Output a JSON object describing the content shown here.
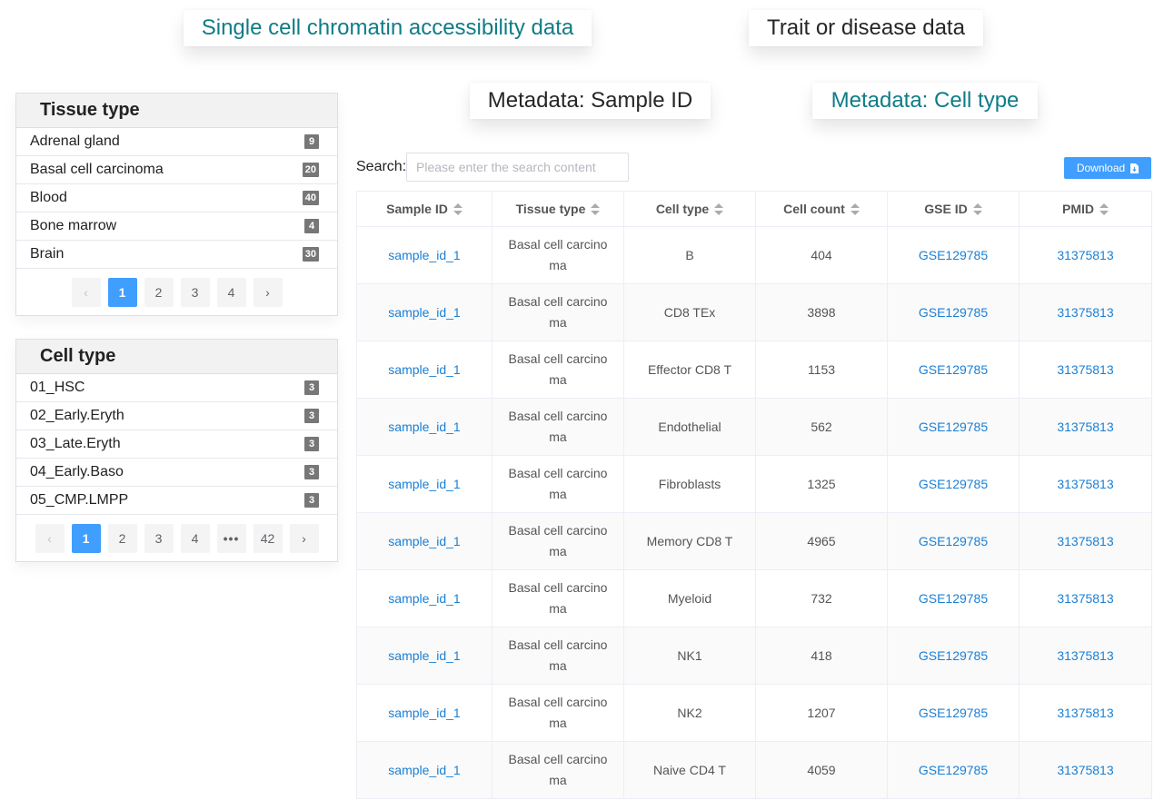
{
  "tabs_top": [
    {
      "label": "Single cell chromatin accessibility data",
      "active": true
    },
    {
      "label": "Trait or disease data",
      "active": false
    }
  ],
  "tabs_meta": [
    {
      "label": "Metadata: Sample ID",
      "active": false
    },
    {
      "label": "Metadata: Cell type",
      "active": true
    }
  ],
  "colors": {
    "accent": "#0f7c86",
    "primary": "#409eff",
    "link": "#1a7fd4",
    "badge": "#777777"
  },
  "tissue_panel": {
    "title": "Tissue type",
    "items": [
      {
        "label": "Adrenal gland",
        "count": "9"
      },
      {
        "label": "Basal cell carcinoma",
        "count": "20"
      },
      {
        "label": "Blood",
        "count": "40"
      },
      {
        "label": "Bone marrow",
        "count": "4"
      },
      {
        "label": "Brain",
        "count": "30"
      }
    ],
    "pagination": {
      "prev": "‹",
      "pages": [
        "1",
        "2",
        "3",
        "4"
      ],
      "current": "1",
      "next": "›"
    }
  },
  "cell_panel": {
    "title": "Cell type",
    "items": [
      {
        "label": "01_HSC",
        "count": "3"
      },
      {
        "label": "02_Early.Eryth",
        "count": "3"
      },
      {
        "label": "03_Late.Eryth",
        "count": "3"
      },
      {
        "label": "04_Early.Baso",
        "count": "3"
      },
      {
        "label": "05_CMP.LMPP",
        "count": "3"
      }
    ],
    "pagination": {
      "prev": "‹",
      "pages": [
        "1",
        "2",
        "3",
        "4",
        "•••",
        "42"
      ],
      "current": "1",
      "next": "›"
    }
  },
  "search": {
    "label": "Search:",
    "placeholder": "Please enter the search content",
    "value": ""
  },
  "download": {
    "label": "Download",
    "icon": "file-download-icon"
  },
  "table": {
    "headers": [
      "Sample ID",
      "Tissue type",
      "Cell type",
      "Cell count",
      "GSE ID",
      "PMID"
    ],
    "rows": [
      {
        "sample_id": "sample_id_1",
        "tissue": "Basal cell carcinoma",
        "cell_type": "B",
        "cell_count": "404",
        "gse": "GSE129785",
        "pmid": "31375813"
      },
      {
        "sample_id": "sample_id_1",
        "tissue": "Basal cell carcinoma",
        "cell_type": "CD8 TEx",
        "cell_count": "3898",
        "gse": "GSE129785",
        "pmid": "31375813"
      },
      {
        "sample_id": "sample_id_1",
        "tissue": "Basal cell carcinoma",
        "cell_type": "Effector CD8 T",
        "cell_count": "1153",
        "gse": "GSE129785",
        "pmid": "31375813"
      },
      {
        "sample_id": "sample_id_1",
        "tissue": "Basal cell carcinoma",
        "cell_type": "Endothelial",
        "cell_count": "562",
        "gse": "GSE129785",
        "pmid": "31375813"
      },
      {
        "sample_id": "sample_id_1",
        "tissue": "Basal cell carcinoma",
        "cell_type": "Fibroblasts",
        "cell_count": "1325",
        "gse": "GSE129785",
        "pmid": "31375813"
      },
      {
        "sample_id": "sample_id_1",
        "tissue": "Basal cell carcinoma",
        "cell_type": "Memory CD8 T",
        "cell_count": "4965",
        "gse": "GSE129785",
        "pmid": "31375813"
      },
      {
        "sample_id": "sample_id_1",
        "tissue": "Basal cell carcinoma",
        "cell_type": "Myeloid",
        "cell_count": "732",
        "gse": "GSE129785",
        "pmid": "31375813"
      },
      {
        "sample_id": "sample_id_1",
        "tissue": "Basal cell carcinoma",
        "cell_type": "NK1",
        "cell_count": "418",
        "gse": "GSE129785",
        "pmid": "31375813"
      },
      {
        "sample_id": "sample_id_1",
        "tissue": "Basal cell carcinoma",
        "cell_type": "NK2",
        "cell_count": "1207",
        "gse": "GSE129785",
        "pmid": "31375813"
      },
      {
        "sample_id": "sample_id_1",
        "tissue": "Basal cell carcinoma",
        "cell_type": "Naive CD4 T",
        "cell_count": "4059",
        "gse": "GSE129785",
        "pmid": "31375813"
      }
    ]
  }
}
